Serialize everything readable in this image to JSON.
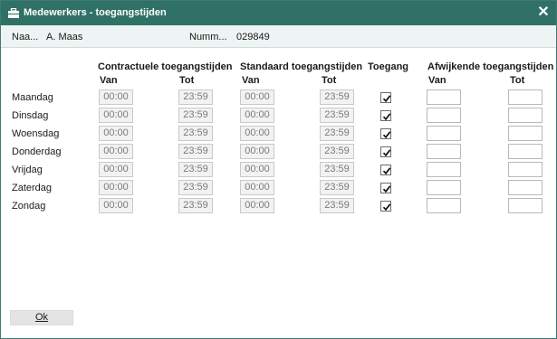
{
  "window": {
    "title": "Medewerkers - toegangstijden",
    "close_label": "✕"
  },
  "info": {
    "name_label": "Naa...",
    "name_value": "A. Maas",
    "number_label": "Numm...",
    "number_value": "029849"
  },
  "headers": {
    "contractual": "Contractuele toegangstijden",
    "standard": "Standaard toegangstijden",
    "access": "Toegang",
    "deviating": "Afwijkende toegangstijden",
    "from": "Van",
    "to": "Tot"
  },
  "rows": [
    {
      "day": "Maandag",
      "contract_from": "00:00",
      "contract_to": "23:59",
      "standard_from": "00:00",
      "standard_to": "23:59",
      "access": true,
      "dev_from": "",
      "dev_to": ""
    },
    {
      "day": "Dinsdag",
      "contract_from": "00:00",
      "contract_to": "23:59",
      "standard_from": "00:00",
      "standard_to": "23:59",
      "access": true,
      "dev_from": "",
      "dev_to": ""
    },
    {
      "day": "Woensdag",
      "contract_from": "00:00",
      "contract_to": "23:59",
      "standard_from": "00:00",
      "standard_to": "23:59",
      "access": true,
      "dev_from": "",
      "dev_to": ""
    },
    {
      "day": "Donderdag",
      "contract_from": "00:00",
      "contract_to": "23:59",
      "standard_from": "00:00",
      "standard_to": "23:59",
      "access": true,
      "dev_from": "",
      "dev_to": ""
    },
    {
      "day": "Vrijdag",
      "contract_from": "00:00",
      "contract_to": "23:59",
      "standard_from": "00:00",
      "standard_to": "23:59",
      "access": true,
      "dev_from": "",
      "dev_to": ""
    },
    {
      "day": "Zaterdag",
      "contract_from": "00:00",
      "contract_to": "23:59",
      "standard_from": "00:00",
      "standard_to": "23:59",
      "access": true,
      "dev_from": "",
      "dev_to": ""
    },
    {
      "day": "Zondag",
      "contract_from": "00:00",
      "contract_to": "23:59",
      "standard_from": "00:00",
      "standard_to": "23:59",
      "access": true,
      "dev_from": "",
      "dev_to": ""
    }
  ],
  "footer": {
    "ok_label": "Ok"
  },
  "colors": {
    "titlebar": "#2f7167",
    "infobar": "#eef4f3"
  },
  "icons": {
    "title": "briefcase-icon",
    "close": "close-icon",
    "check": "checkmark-icon"
  }
}
